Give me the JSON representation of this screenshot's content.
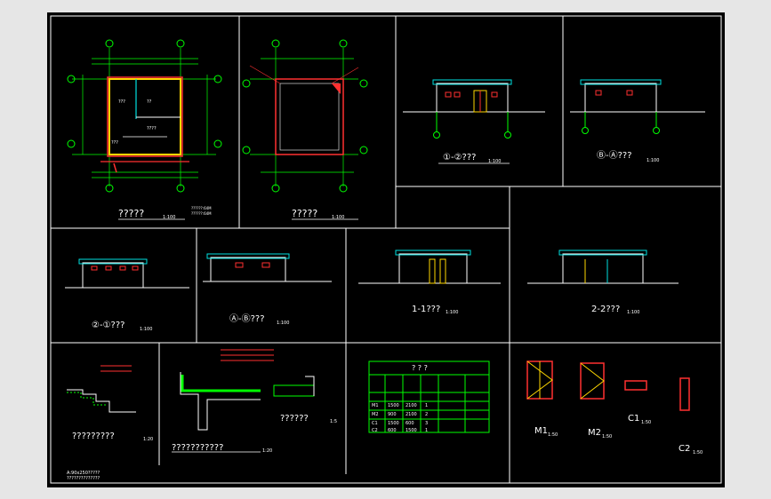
{
  "drawing": {
    "background": "#000000",
    "frame_color": "#ffffff",
    "accent_colors": {
      "wall": "#ff3030",
      "axis": "#00ff00",
      "dim": "#ffffff",
      "window": "#ff0000",
      "door": "#ffd700",
      "cyan": "#00e0e0"
    },
    "titles": {
      "plan1": "?????",
      "plan1_scale": "1:100",
      "plan1_note": "??????:64M",
      "plan1_note2": "??????:64M",
      "plan2": "?????",
      "plan2_scale": "1:100",
      "elev_1_2": "①-②???",
      "elev_1_2_scale": "1:100",
      "elev_b_a": "Ⓑ-Ⓐ???",
      "elev_b_a_scale": "1:100",
      "elev_2_1": "②-①???",
      "elev_2_1_scale": "1:100",
      "elev_a_b": "Ⓐ-Ⓑ???",
      "elev_a_b_scale": "1:100",
      "sect_1": "1-1???",
      "sect_1_scale": "1:100",
      "sect_2": "2-2???",
      "sect_2_scale": "1:100",
      "detail1": "?????????",
      "detail1_scale": "1:20",
      "detail2": "???????????",
      "detail2_scale": "1:20",
      "detail3": "??????",
      "detail3_scale": "1:5",
      "table_title": "? ? ?",
      "m1": "M1",
      "m1_scale": "1:50",
      "m2": "M2",
      "m2_scale": "1:50",
      "c1": "C1",
      "c1_scale": "1:50",
      "c2": "C2",
      "c2_scale": "1:50",
      "footnote1": "A:90x250?????",
      "footnote2": "??????????????"
    },
    "axis_labels": {
      "one": "1",
      "two": "2",
      "a": "A",
      "b": "B",
      "three": "3"
    },
    "table_rows": [
      [
        "M1",
        "1500",
        "2100",
        "1",
        ""
      ],
      [
        "M2",
        "900",
        "2100",
        "2",
        ""
      ],
      [
        "C1",
        "1500",
        "600",
        "3",
        ""
      ],
      [
        "C2",
        "600",
        "1500",
        "1",
        ""
      ]
    ]
  }
}
